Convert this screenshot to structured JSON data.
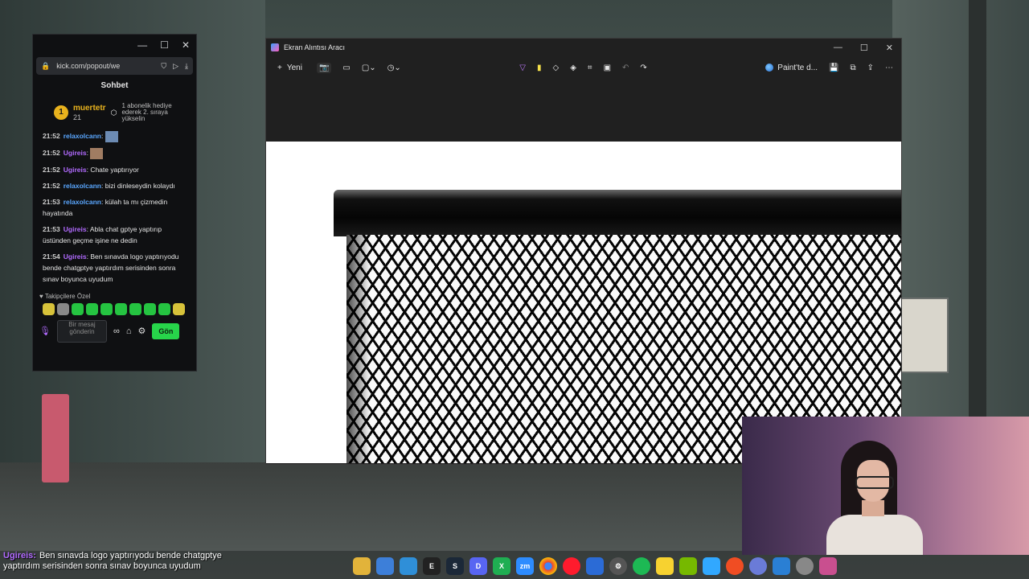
{
  "chat_window": {
    "url": "kick.com/popout/we",
    "title": "Sohbet",
    "subscriber": {
      "rank": "1",
      "name": "muertetr",
      "count": "21",
      "note": "1 abonelik hediye ederek 2. sıraya yükselin"
    },
    "messages": [
      {
        "time": "21:52",
        "user": "relaxolcann",
        "user_color": "blue",
        "text": "",
        "has_image": true
      },
      {
        "time": "21:52",
        "user": "Ugireis",
        "user_color": "purple",
        "text": "",
        "has_image": true
      },
      {
        "time": "21:52",
        "user": "Ugireis",
        "user_color": "purple",
        "text": "Chate yaptırıyor"
      },
      {
        "time": "21:52",
        "user": "relaxolcann",
        "user_color": "blue",
        "text": "bizi dinleseydin kolaydı"
      },
      {
        "time": "21:53",
        "user": "relaxolcann",
        "user_color": "blue",
        "text": "külah ta mı çizmedin hayatında"
      },
      {
        "time": "21:53",
        "user": "Ugireis",
        "user_color": "purple",
        "text": "Abla chat gptye yaptırıp üstünden geçme işine ne dedin"
      },
      {
        "time": "21:54",
        "user": "Ugireis",
        "user_color": "purple",
        "text": "Ben sınavda logo yaptırıyodu bende chatgptye yaptırdım serisinden sonra sınav boyunca uyudum"
      }
    ],
    "emotes_title": "Takipçilere Özel",
    "input_placeholder": "Bir mesaj gönderin",
    "send_label": "Gön"
  },
  "snipping_tool": {
    "title": "Ekran Alıntısı Aracı",
    "new_label": "Yeni",
    "paint_label": "Paint'te d..."
  },
  "subtitle": {
    "name": "Ugireis:",
    "text": "Ben sınavda logo yaptırıyodu bende chatgptye yaptırdım serisinden sonra sınav boyunca uyudum"
  },
  "taskbar_apps": [
    "file-explorer",
    "store",
    "edge",
    "epic-games",
    "steam",
    "discord",
    "xbox",
    "zoom",
    "chrome",
    "opera",
    "app",
    "settings",
    "spotify",
    "notes",
    "nvidia",
    "photoshop",
    "app2",
    "app3",
    "vscode",
    "app4",
    "snipping-tool"
  ],
  "colors": {
    "kick_green": "#27d54a",
    "user_blue": "#5aa7ff",
    "user_purple": "#b26bff"
  }
}
